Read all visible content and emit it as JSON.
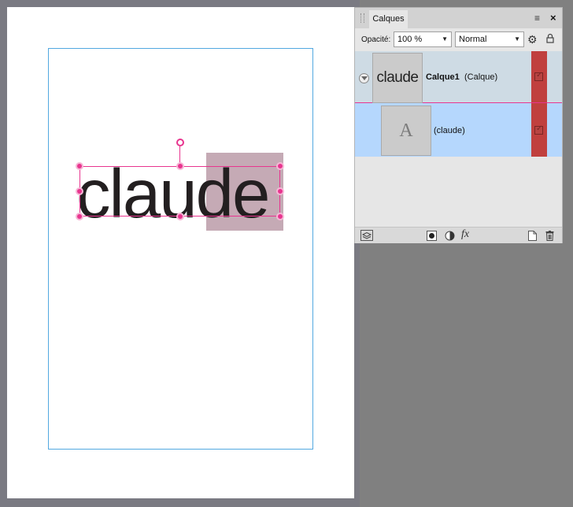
{
  "document": {
    "art_text": "claude"
  },
  "layers_panel": {
    "tab_label": "Calques",
    "menu_icon": "≡",
    "close_icon": "×",
    "opacity_label": "Opacité:",
    "opacity_value": "100 %",
    "blend_mode": "Normal",
    "layers": [
      {
        "thumb_text": "claude",
        "name": "Calque1",
        "type": "(Calque)",
        "visible": true
      },
      {
        "thumb_text": "A",
        "name": "(claude)",
        "visible": true
      }
    ]
  },
  "colors": {
    "selection": "#e8358f",
    "margin_guide": "#52a8e0",
    "selected_layer_bg": "#b5d7fd",
    "visibility_column": "#c0403e"
  },
  "icons": [
    "gear-icon",
    "lock-icon",
    "layers-icon",
    "mask-icon",
    "adjustment-icon",
    "fx-icon",
    "new-layer-icon",
    "trash-icon"
  ]
}
